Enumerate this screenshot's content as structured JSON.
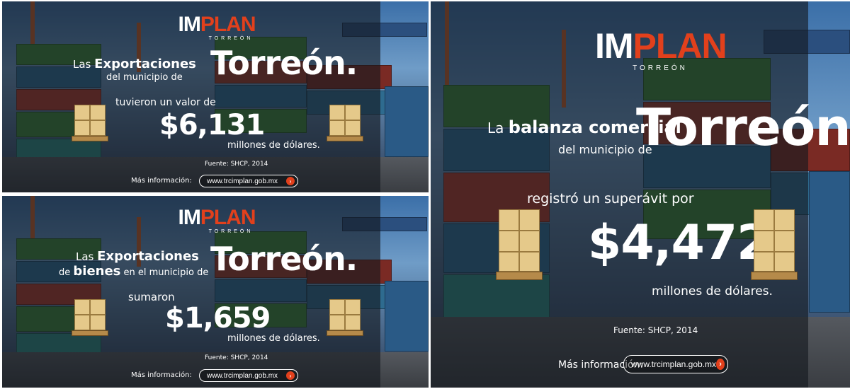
{
  "logo": {
    "im": "IM",
    "plan": "PLAN",
    "sub": "TORREÓN"
  },
  "panel1": {
    "line1_prefix": "Las",
    "line1_bold": "Exportaciones",
    "line2": "del municipio de",
    "city": "Torreón.",
    "line3": "tuvieron un valor de",
    "amount": "$6,131",
    "unit": "millones de dólares.",
    "source": "Fuente: SHCP, 2014",
    "more_label": "Más información:",
    "url": "www.trcimplan.gob.mx"
  },
  "panel2": {
    "line1_prefix": "Las",
    "line1_bold": "Exportaciones",
    "line2_prefix": "de",
    "line2_bold": "bienes",
    "line2_suffix": "en el municipio de",
    "city": "Torreón.",
    "line3": "sumaron",
    "amount": "$1,659",
    "unit": "millones de dólares.",
    "source": "Fuente: SHCP, 2014",
    "more_label": "Más información:",
    "url": "www.trcimplan.gob.mx"
  },
  "panel3": {
    "line1_prefix": "La",
    "line1_bold": "balanza comercial",
    "line2": "del municipio de",
    "city": "Torreón.",
    "line3": "registró un superávit por",
    "amount": "$4,472",
    "unit": "millones de dólares.",
    "source": "Fuente: SHCP, 2014",
    "more_label": "Más información:",
    "url": "www.trcimplan.gob.mx"
  },
  "colors": {
    "brand_orange": "#e2401c",
    "overlay": "rgba(20,24,30,0.62)"
  },
  "icons": {
    "arrow": "arrow-right-icon",
    "pallet": "pallet-boxes-icon"
  }
}
